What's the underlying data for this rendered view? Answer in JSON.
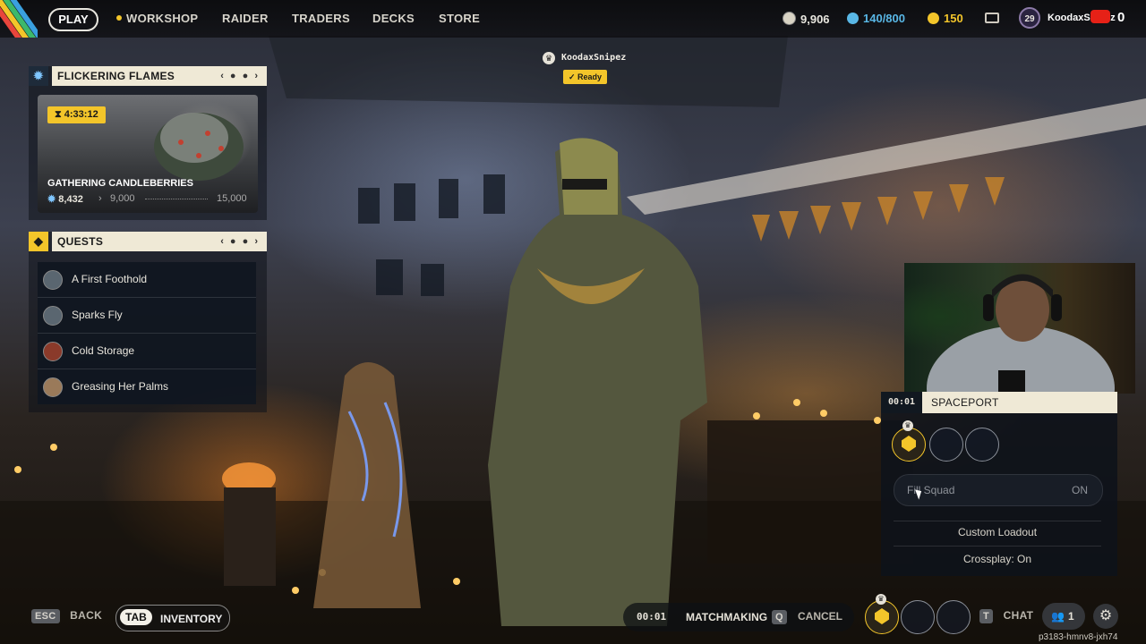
{
  "nav": {
    "play": "PLAY",
    "items": [
      "WORKSHOP",
      "RAIDER",
      "TRADERS",
      "DECKS",
      "STORE"
    ]
  },
  "currencies": {
    "coins": "9,906",
    "capacity": "140/800",
    "tokens": "150"
  },
  "profile": {
    "level": "29",
    "username": "KoodaxSnipez",
    "count": "0"
  },
  "player_tag": {
    "name": "KoodaxSnipez",
    "status": "Ready"
  },
  "event": {
    "title": "FLICKERING FLAMES",
    "timer": "4:33:12",
    "challenge": "GATHERING CANDLEBERRIES",
    "progress_current": "8,432",
    "milestone": "9,000",
    "goal": "15,000",
    "progress_fraction": 0.56
  },
  "quests": {
    "title": "QUESTS",
    "items": [
      "A First Foothold",
      "Sparks Fly",
      "Cold Storage",
      "Greasing Her Palms"
    ]
  },
  "squad": {
    "timer": "00:01",
    "location": "SPACEPORT",
    "fill_squad_label": "Fill Squad",
    "fill_squad_value": "ON",
    "custom_loadout": "Custom Loadout",
    "crossplay": "Crossplay: On"
  },
  "bottom": {
    "esc_key": "ESC",
    "back": "BACK",
    "tab_key": "TAB",
    "inventory": "INVENTORY",
    "mm_timer": "00:01",
    "matchmaking": "MATCHMAKING",
    "cancel_key": "Q",
    "cancel": "CANCEL",
    "chat_key": "T",
    "chat": "CHAT",
    "friends_count": "1"
  },
  "session_id": "p3183-hmnv8-jxh74",
  "colors": {
    "accent_yellow": "#f3c52a",
    "panel_cream": "#efe9d6",
    "panel_dark": "#10161f",
    "capacity_blue": "#59b7e6"
  }
}
